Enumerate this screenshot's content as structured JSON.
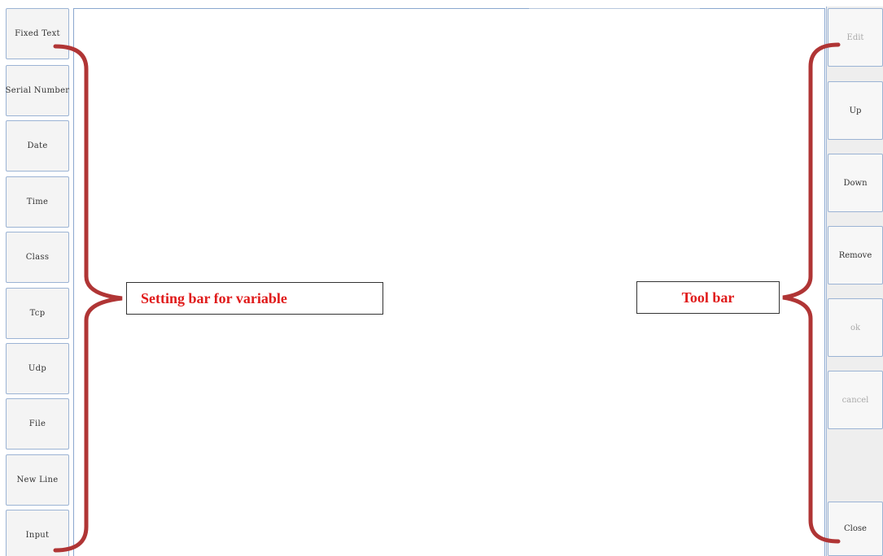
{
  "left_bar": {
    "buttons": [
      {
        "label": "Fixed Text"
      },
      {
        "label": "Serial Number"
      },
      {
        "label": "Date"
      },
      {
        "label": "Time"
      },
      {
        "label": "Class"
      },
      {
        "label": "Tcp"
      },
      {
        "label": "Udp"
      },
      {
        "label": "File"
      },
      {
        "label": "New Line"
      },
      {
        "label": "Input"
      }
    ]
  },
  "right_bar": {
    "buttons": [
      {
        "label": "Edit",
        "enabled": false
      },
      {
        "label": "Up",
        "enabled": true
      },
      {
        "label": "Down",
        "enabled": true
      },
      {
        "label": "Remove",
        "enabled": true
      },
      {
        "label": "ok",
        "enabled": false
      },
      {
        "label": "cancel",
        "enabled": false
      },
      {
        "label": "Close",
        "enabled": true
      }
    ]
  },
  "annotations": {
    "left_label": "Setting bar for variable",
    "right_label": "Tool bar"
  },
  "colors": {
    "annotation_text": "#e01b1b",
    "bracket": "#b03535",
    "button_border": "#9bb3d4"
  }
}
